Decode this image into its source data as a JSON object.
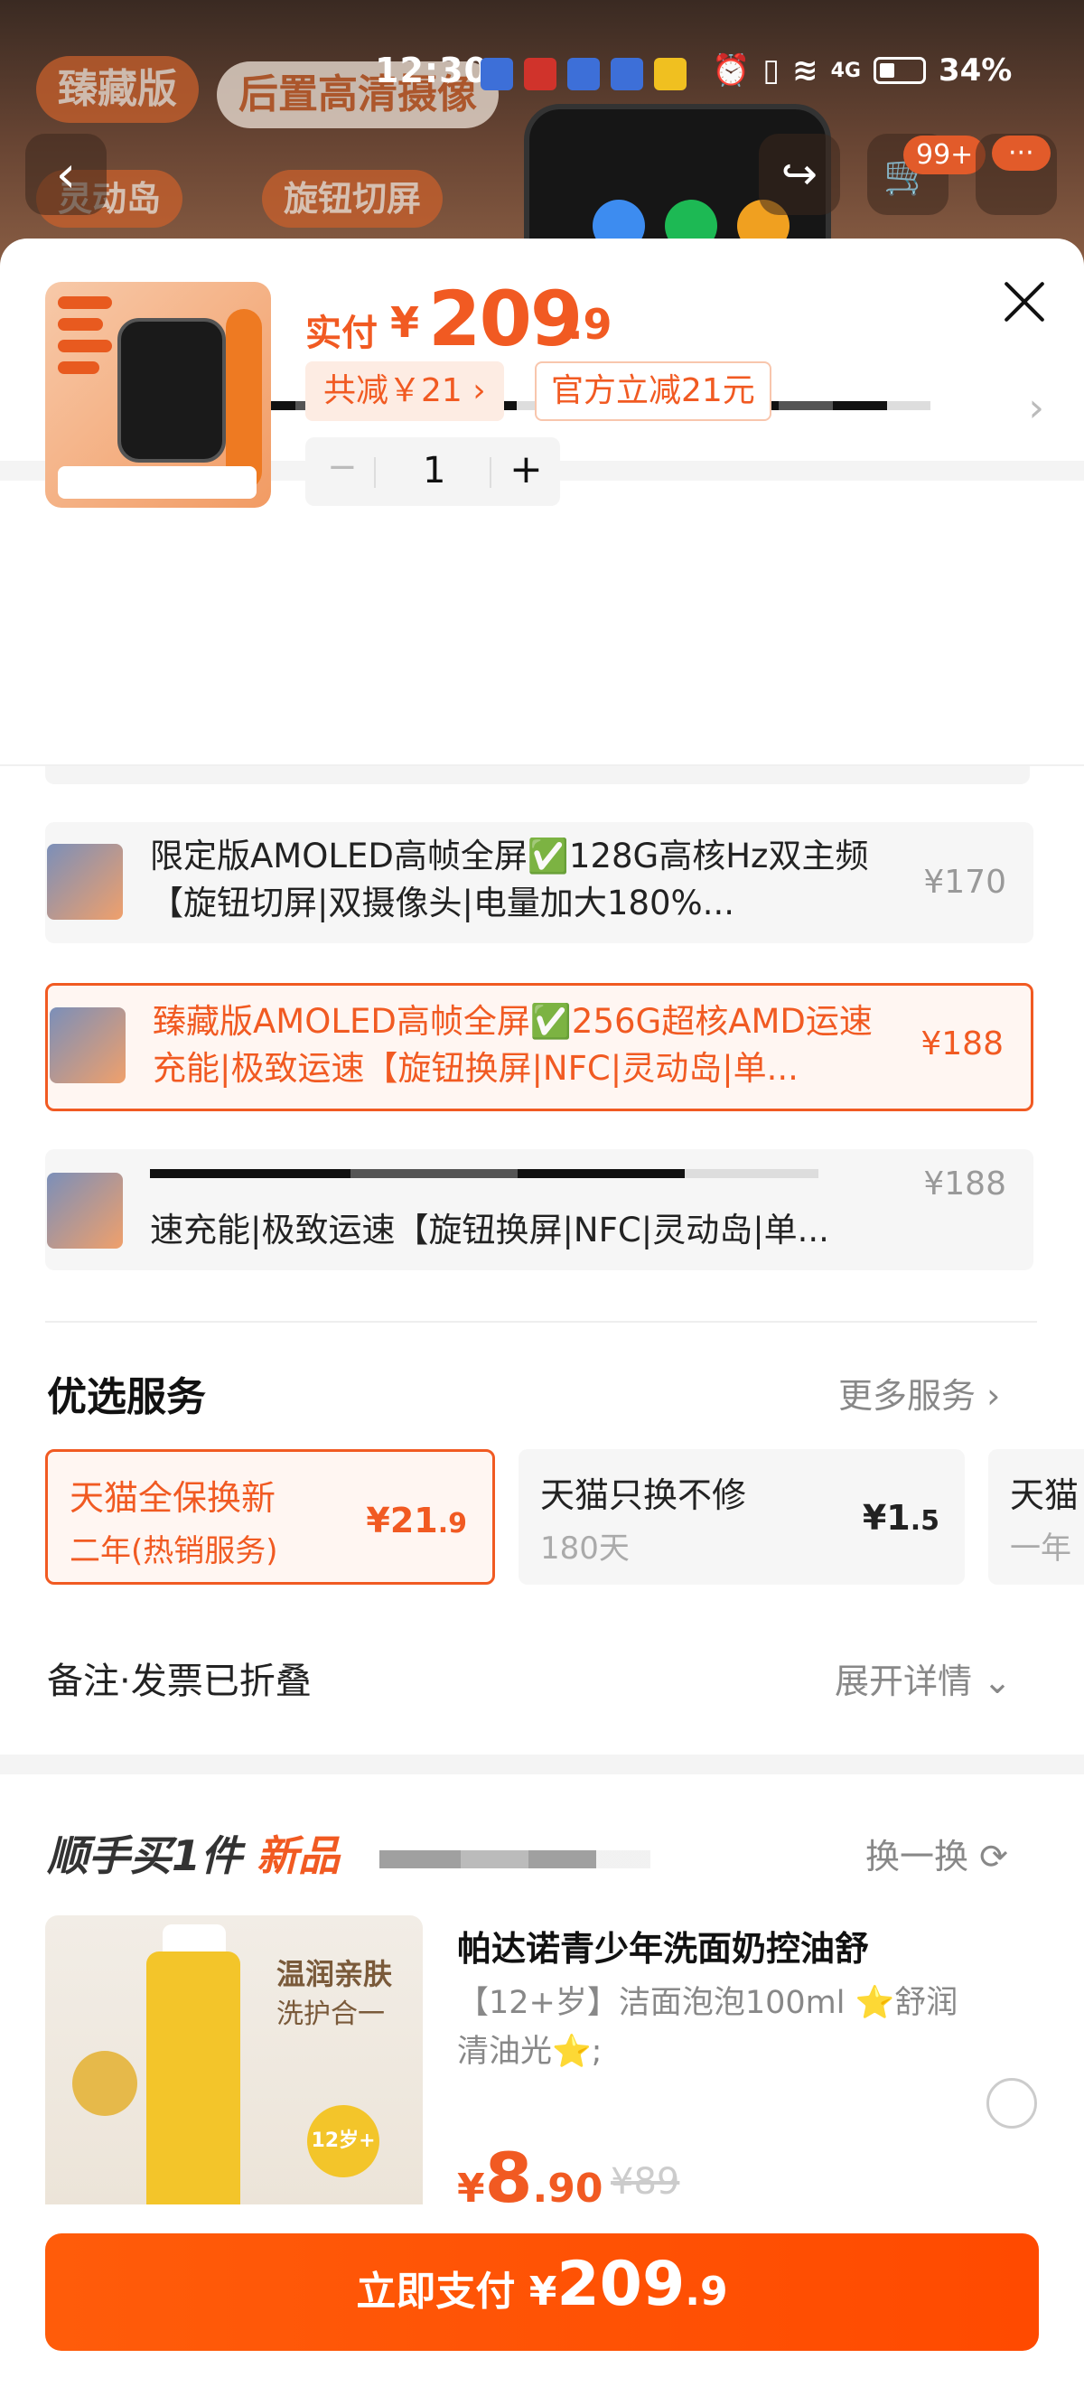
{
  "status_bar": {
    "time": "12:30",
    "battery": "34%",
    "signal": "4G"
  },
  "background_page": {
    "pill_1": "臻藏版",
    "pill_2": "后置高清摄像",
    "pill_3": "灵动岛",
    "pill_4": "旋钮切屏",
    "cart_badge": "99+",
    "more_badge": "···"
  },
  "product": {
    "pay_label": "实付",
    "currency": "¥",
    "price_int": "209",
    "price_dec": ".9",
    "discount_chip": "共减￥21 ›",
    "official_chip": "官方立减21元",
    "quantity": "1",
    "minus": "−",
    "plus": "+"
  },
  "sku_options": [
    {
      "title": "限定版AMOLED高帧全屏✅128G高核Hz双主频【旋钮切屏|双摄像头|电量加大180%...",
      "price": "¥170",
      "selected": false
    },
    {
      "title": "臻藏版AMOLED高帧全屏✅256G超核AMD运速充能|极致运速【旋钮换屏|NFC|灵动岛|单...",
      "price": "¥188",
      "selected": true
    },
    {
      "title": "速充能|极致运速【旋钮换屏|NFC|灵动岛|单...",
      "price": "¥188",
      "selected": false
    }
  ],
  "services": {
    "title": "优选服务",
    "more": "更多服务 ›",
    "items": [
      {
        "name": "天猫全保换新",
        "sub": "二年(热销服务)",
        "price_int": "21",
        "price_dec": ".9",
        "selected": true
      },
      {
        "name": "天猫只换不修",
        "sub": "180天",
        "price_int": "1",
        "price_dec": ".5",
        "selected": false
      },
      {
        "name": "天猫",
        "sub": "一年",
        "price_int": "",
        "price_dec": "",
        "selected": false
      }
    ]
  },
  "notes": {
    "label": "备注·发票已折叠",
    "expand": "展开详情 ⌄"
  },
  "addon": {
    "title_prefix": "顺手买1件",
    "title_new": "新品",
    "swap": "换一换",
    "img_tag_1": "温润亲肤",
    "img_tag_2": "洗护合一",
    "img_badge": "12岁+",
    "name": "帕达诺青少年洗面奶控油舒",
    "desc": "【12+岁】洁面泡泡100ml ⭐舒润清油光⭐;",
    "price_int": "8",
    "price_dec": ".90",
    "orig_price": "¥89"
  },
  "pay_button": {
    "label": "立即支付 ¥",
    "amount_int": "209",
    "amount_dec": ".9"
  },
  "colors": {
    "accent": "#f15a22",
    "accent_bg": "#fff6f2",
    "pay_button": "#ff5000"
  }
}
